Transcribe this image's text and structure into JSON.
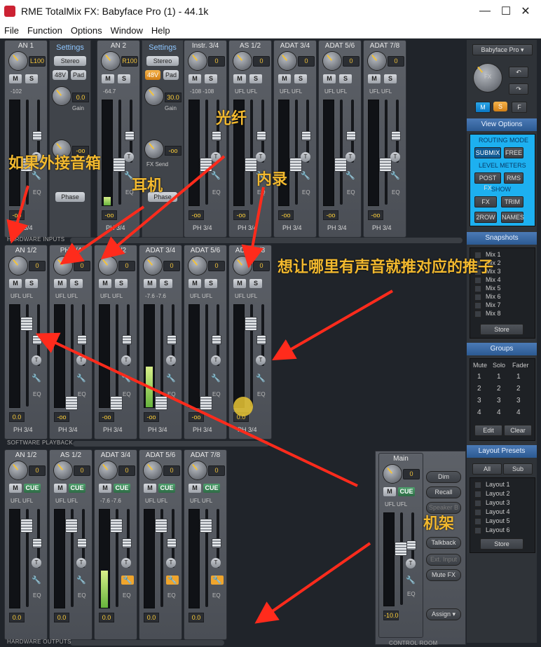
{
  "window": {
    "title": "RME TotalMix FX: Babyface Pro (1) - 44.1k",
    "minimize": "—",
    "maximize": "☐",
    "close": "✕"
  },
  "menu": [
    "File",
    "Function",
    "Options",
    "Window",
    "Help"
  ],
  "rows": {
    "hardware_inputs": {
      "label": "HARDWARE INPUTS"
    },
    "software_playback": {
      "label": "SOFTWARE PLAYBACK"
    },
    "hardware_outputs": {
      "label": "HARDWARE OUTPUTS"
    },
    "control_room": {
      "label": "CONTROL ROOM"
    }
  },
  "inputs": [
    {
      "name": "AN 1",
      "knob": "L100",
      "ph": "PH 3/4",
      "level": "-102",
      "gain": "0.0",
      "gain_label": "Gain",
      "bottom": "-oo"
    },
    {
      "name": "AN 2",
      "knob": "R100",
      "ph": "PH 3/4",
      "level": "-64.7",
      "gain": "30.0",
      "gain_label": "Gain",
      "bottom": "-oo"
    },
    {
      "name": "Instr. 3/4",
      "knob": "0",
      "ph": "PH 3/4",
      "level": "-108 -108",
      "bottom": "-oo"
    },
    {
      "name": "AS 1/2",
      "knob": "0",
      "ph": "PH 3/4",
      "level": "UFL UFL",
      "bottom": "-oo"
    },
    {
      "name": "ADAT 3/4",
      "knob": "0",
      "ph": "PH 3/4",
      "level": "UFL UFL",
      "bottom": "-oo"
    },
    {
      "name": "ADAT 5/6",
      "knob": "0",
      "ph": "PH 3/4",
      "level": "UFL UFL",
      "bottom": "-oo"
    },
    {
      "name": "ADAT 7/8",
      "knob": "0",
      "ph": "PH 3/4",
      "level": "UFL UFL",
      "bottom": "-oo"
    }
  ],
  "settings": [
    {
      "header": "Settings",
      "stereo": "Stereo",
      "p48": "48V",
      "pad": "Pad",
      "gain": "0.0",
      "gain_label": "Gain",
      "fxsend": "-oo",
      "phase": "Phase"
    },
    {
      "header": "Settings",
      "stereo": "Stereo",
      "p48": "48V",
      "pad": "Pad",
      "gain": "30.0",
      "gain_label": "Gain",
      "fxsend": "-oo",
      "fxsend_label": "FX Send",
      "phase": "Phase"
    }
  ],
  "playback": [
    {
      "name": "AN 1/2",
      "knob": "0",
      "level": "UFL UFL",
      "bottom": "0.0",
      "ph": "PH 3/4"
    },
    {
      "name": "PH 3/4",
      "knob": "0",
      "level": "UFL UFL",
      "bottom": "-oo",
      "ph": "PH 3/4"
    },
    {
      "name": "AS 1/2",
      "knob": "0",
      "level": "UFL UFL",
      "bottom": "-oo",
      "ph": "PH 3/4"
    },
    {
      "name": "ADAT 3/4",
      "knob": "0",
      "level": "-7.6 -7.6",
      "bottom": "-oo",
      "ph": "PH 3/4"
    },
    {
      "name": "ADAT 5/6",
      "knob": "0",
      "level": "UFL UFL",
      "bottom": "-oo",
      "ph": "PH 3/4"
    },
    {
      "name": "ADAT 7/8",
      "knob": "0",
      "level": "UFL UFL",
      "bottom": "0.0",
      "ph": "PH 3/4"
    }
  ],
  "outputs": [
    {
      "name": "AN 1/2",
      "knob": "0",
      "level": "UFL UFL",
      "bottom": "0.0",
      "cue": "CUE"
    },
    {
      "name": "AS 1/2",
      "knob": "0",
      "level": "UFL UFL",
      "bottom": "0.0",
      "cue": "CUE"
    },
    {
      "name": "ADAT 3/4",
      "knob": "0",
      "level": "-7.6 -7.6",
      "bottom": "0.0",
      "cue": "CUE"
    },
    {
      "name": "ADAT 5/6",
      "knob": "0",
      "level": "UFL UFL",
      "bottom": "0.0",
      "cue": "CUE"
    },
    {
      "name": "ADAT 7/8",
      "knob": "0",
      "level": "UFL UFL",
      "bottom": "0.0",
      "cue": "CUE"
    }
  ],
  "main": {
    "name": "Main",
    "knob": "0",
    "level": "UFL UFL",
    "bottom": "-10.0",
    "cue": "CUE",
    "buttons": [
      "Dim",
      "Recall",
      "Speaker B",
      "Talkback",
      "Ext. Input",
      "Mute FX"
    ],
    "assign": "Assign ▾"
  },
  "sidebar": {
    "device": "Babyface Pro ▾",
    "fx": "FX",
    "mode": [
      "M",
      "S",
      "F"
    ],
    "view_options": "View Options",
    "routing_mode": "ROUTING MODE",
    "submix": "SUBMIX",
    "free": "FREE",
    "level_meters": "LEVEL METERS",
    "postfx": "POST FX",
    "rms": "RMS",
    "show": "SHOW",
    "fx_btn": "FX",
    "trim": "TRIM",
    "row2": "2ROW",
    "names": "NAMES",
    "snapshots": "Snapshots",
    "mixes": [
      "Mix 1",
      "Mix 2",
      "Mix 3",
      "Mix 4",
      "Mix 5",
      "Mix 6",
      "Mix 7",
      "Mix 8"
    ],
    "store": "Store",
    "groups": "Groups",
    "groups_cols": [
      "Mute",
      "Solo",
      "Fader"
    ],
    "groups_nums": [
      "1",
      "2",
      "3",
      "4"
    ],
    "edit": "Edit",
    "clear": "Clear",
    "layout_presets": "Layout Presets",
    "all": "All",
    "sub": "Sub",
    "layouts": [
      "Layout 1",
      "Layout 2",
      "Layout 3",
      "Layout 4",
      "Layout 5",
      "Layout 6"
    ],
    "store2": "Store"
  },
  "annotations": {
    "external_speakers": "如果外接音箱",
    "headphones": "耳机",
    "fiber": "光纤",
    "internal_record": "内录",
    "push_fader": "想让哪里有声音就推对应的推子",
    "rack": "机架"
  },
  "colors": {
    "accent_orange": "#f2b92f",
    "arrow_red": "#ff2b1c",
    "strip_gray": "#555a61",
    "highlight_blue": "#2aa6e8"
  }
}
